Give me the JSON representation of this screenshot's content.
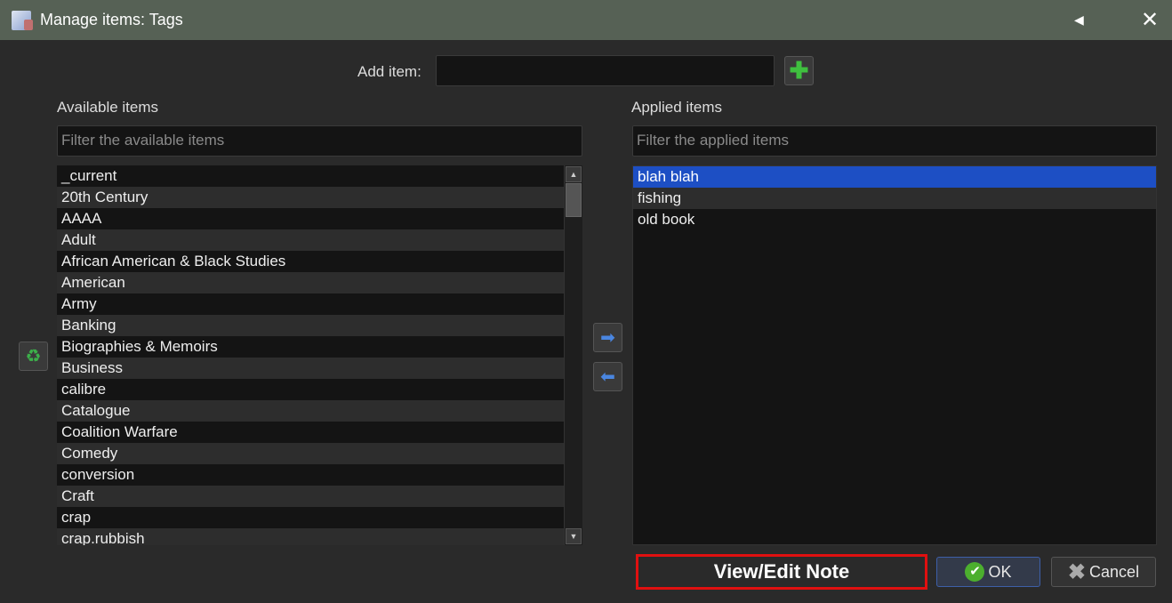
{
  "window": {
    "title": "Manage items: Tags"
  },
  "add": {
    "label": "Add item:",
    "value": ""
  },
  "available": {
    "heading": "Available items",
    "filter_placeholder": "Filter the available items",
    "items": [
      "_current",
      "20th Century",
      "AAAA",
      "Adult",
      "African American & Black Studies",
      "American",
      "Army",
      "Banking",
      "Biographies & Memoirs",
      "Business",
      "calibre",
      "Catalogue",
      "Coalition Warfare",
      "Comedy",
      "conversion",
      "Craft",
      "crap",
      "crap.rubbish"
    ]
  },
  "applied": {
    "heading": "Applied items",
    "filter_placeholder": "Filter the applied items",
    "items": [
      "blah blah",
      "fishing",
      "old book"
    ],
    "selected": 0
  },
  "buttons": {
    "note": "View/Edit Note",
    "ok": "OK",
    "cancel": "Cancel"
  },
  "colors": {
    "titlebar": "#566155",
    "selection": "#1d4fc4",
    "highlight": "#e01010"
  }
}
